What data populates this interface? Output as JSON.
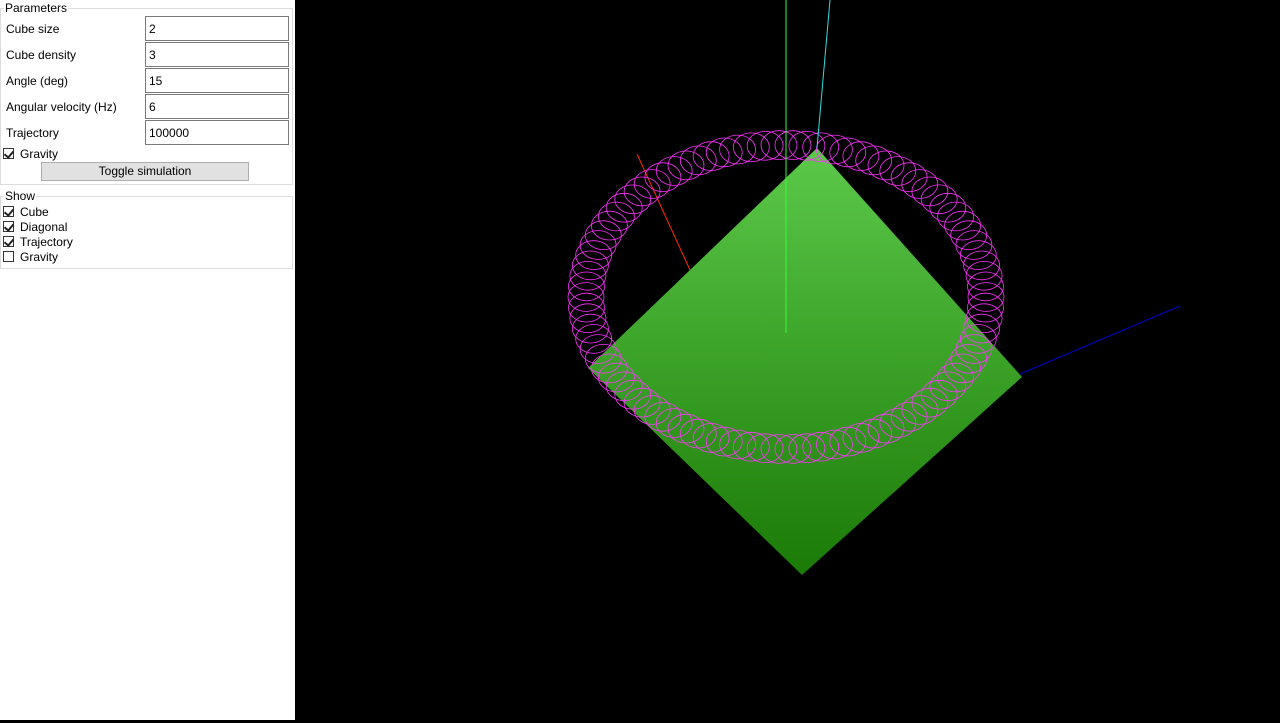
{
  "parameters": {
    "title": "Parameters",
    "fields": [
      {
        "label": "Cube size",
        "value": "2"
      },
      {
        "label": "Cube density",
        "value": "3"
      },
      {
        "label": "Angle (deg)",
        "value": "15"
      },
      {
        "label": "Angular velocity (Hz)",
        "value": "6"
      },
      {
        "label": "Trajectory",
        "value": "100000"
      }
    ],
    "gravity_label": "Gravity",
    "gravity_checked": true,
    "toggle_label": "Toggle simulation"
  },
  "show": {
    "title": "Show",
    "items": [
      {
        "label": "Cube",
        "checked": true
      },
      {
        "label": "Diagonal",
        "checked": true
      },
      {
        "label": "Trajectory",
        "checked": true
      },
      {
        "label": "Gravity",
        "checked": false
      }
    ]
  },
  "scene": {
    "colors": {
      "background": "#000000",
      "cube_top": "#5cc94a",
      "cube_bottom": "#1a7a06",
      "trajectory": "#ff33ff",
      "axis_red": "#ff2a00",
      "axis_green": "#33ff33",
      "axis_blue": "#0000cc",
      "diagonal": "#33dddd"
    }
  }
}
